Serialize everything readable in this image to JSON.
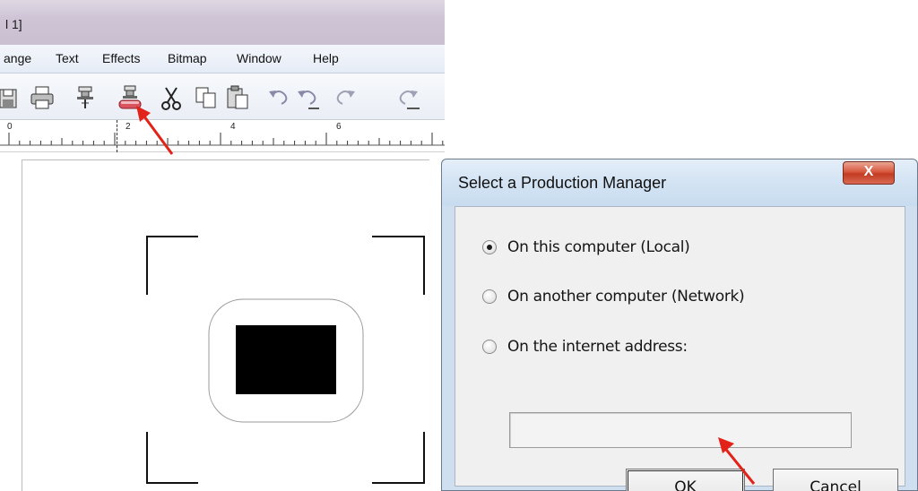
{
  "window": {
    "title": "l 1]"
  },
  "menubar": {
    "items": [
      "ange",
      "Text",
      "Effects",
      "Bitmap",
      "Window",
      "Help"
    ]
  },
  "toolbar": {
    "icons": [
      "save-icon",
      "print-icon",
      "production-manager-icon",
      "send-to-production-icon",
      "cut-icon",
      "copy-icon",
      "paste-icon",
      "undo-icon",
      "undo-list-icon",
      "redo-icon",
      "redo-list-icon"
    ]
  },
  "ruler": {
    "labels": [
      "0",
      "2",
      "4",
      "6"
    ]
  },
  "dialog": {
    "title": "Select a Production Manager",
    "close_label": "X",
    "options": [
      {
        "label": "On this computer (Local)",
        "selected": true
      },
      {
        "label": "On another computer (Network)",
        "selected": false
      },
      {
        "label": "On the internet address:",
        "selected": false
      }
    ],
    "address_value": "",
    "ok_label": "OK",
    "cancel_label": "Cancel"
  },
  "colors": {
    "annotation_arrow": "#e2231a",
    "close_button": "#c9432a",
    "dialog_frame": "#cfdff0"
  }
}
